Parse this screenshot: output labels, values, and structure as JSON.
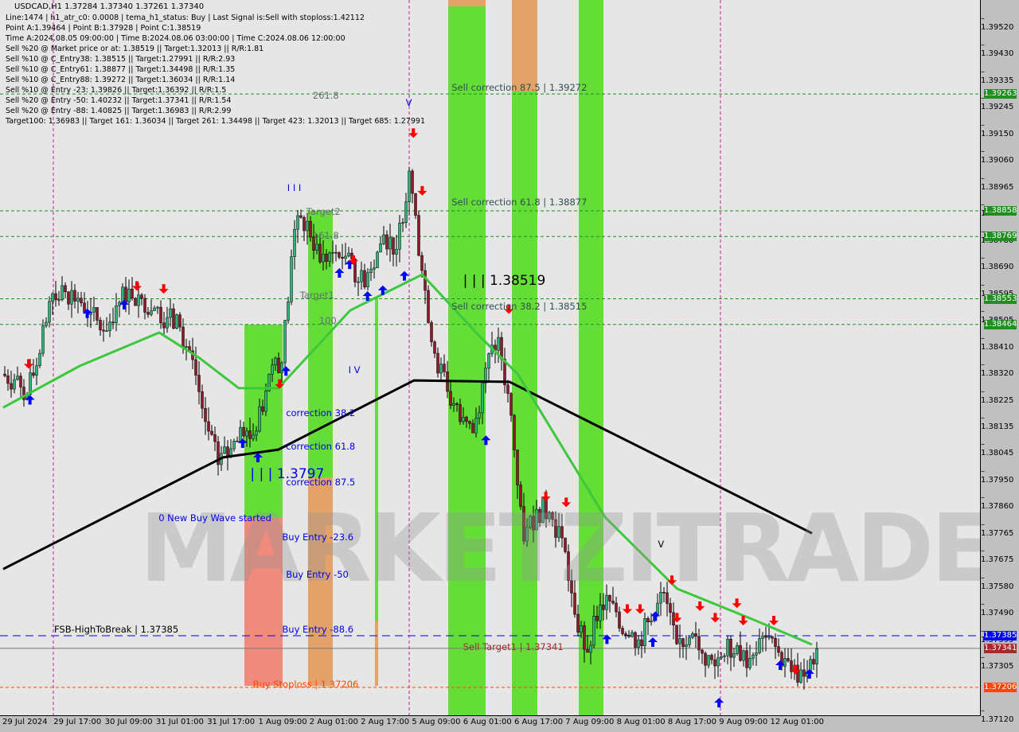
{
  "header": {
    "title": "USDCAD,H1  1.37284 1.37340 1.37261 1.37340",
    "lines": [
      "Line:1474 | h1_atr_c0: 0.0008 | tema_h1_status: Buy | Last Signal is:Sell with stoploss:1.42112",
      "Point A:1.39464 | Point B:1.37928 | Point C:1.38519",
      "Time A:2024.08.05 09:00:00 | Time B:2024.08.06 03:00:00 | Time C:2024.08.06 12:00:00",
      "Sell %20 @ Market price or at: 1.38519 || Target:1.32013 || R/R:1.81",
      "Sell %10 @ C_Entry38: 1.38515 || Target:1.27991 || R/R:2.93",
      "Sell %10 @ C_Entry61: 1.38877 || Target:1.34498 || R/R:1.35",
      "Sell %10 @ C_Entry88: 1.39272 || Target:1.36034 || R/R:1.14",
      "Sell %10 @ Entry -23: 1.39826 || Target:1.36392 || R/R:1.5",
      "Sell %20 @ Entry -50: 1.40232 || Target:1.37341 || R/R:1.54",
      "Sell %20 @ Entry -88: 1.40825 || Target:1.36983 || R/R:2.99",
      "Target100: 1.36983 || Target 161: 1.36034 || Target 261: 1.34498 || Target 423: 1.32013 || Target 685: 1.27991"
    ]
  },
  "watermark": "MARKETZITRADE",
  "colors": {
    "bull": "#2fb47a",
    "bear": "#8b1a2a",
    "ma_fast": "#3cc83c",
    "ma_slow": "#000000",
    "green_zone": "#55dd22",
    "orange_zone": "#e39a5a",
    "salmon_zone": "#f08070",
    "level_green": "#1f8f1f",
    "level_blue": "#0000ff",
    "level_red": "#a52a2a",
    "level_orange": "#ff4500"
  },
  "chart_data": {
    "type": "candlestick",
    "symbol": "USDCAD",
    "timeframe": "H1",
    "ylim": [
      1.3712,
      1.3952
    ],
    "y_ticks": [
      "1.39520",
      "1.39430",
      "1.39335",
      "1.39245",
      "1.39150",
      "1.39060",
      "1.38965",
      "1.38875",
      "1.38780",
      "1.38690",
      "1.38595",
      "1.38505",
      "1.38410",
      "1.38320",
      "1.38225",
      "1.38135",
      "1.38045",
      "1.37950",
      "1.37860",
      "1.37765",
      "1.37675",
      "1.37580",
      "1.37490",
      "1.37395",
      "1.37305",
      "1.37120"
    ],
    "x_ticks": [
      "29 Jul 2024",
      "29 Jul 17:00",
      "30 Jul 09:00",
      "31 Jul 01:00",
      "31 Jul 17:00",
      "1 Aug 09:00",
      "2 Aug 01:00",
      "2 Aug 17:00",
      "5 Aug 09:00",
      "6 Aug 01:00",
      "6 Aug 17:00",
      "7 Aug 09:00",
      "8 Aug 01:00",
      "8 Aug 17:00",
      "9 Aug 09:00",
      "12 Aug 01:00"
    ],
    "closes_4h": [
      1.38292,
      1.38273,
      1.38221,
      1.38364,
      1.38571,
      1.38577,
      1.38555,
      1.38507,
      1.38441,
      1.38529,
      1.38587,
      1.38555,
      1.38521,
      1.38488,
      1.38455,
      1.38342,
      1.38127,
      1.37978,
      1.38033,
      1.38077,
      1.38094,
      1.38292,
      1.38331,
      1.38794,
      1.38822,
      1.38681,
      1.38714,
      1.38701,
      1.38612,
      1.38656,
      1.38775,
      1.38725,
      1.38996,
      1.38651,
      1.38364,
      1.38232,
      1.38127,
      1.38088,
      1.38312,
      1.38419,
      1.38149,
      1.37713,
      1.37823,
      1.37812,
      1.37724,
      1.37459,
      1.37327,
      1.37492,
      1.37498,
      1.37387,
      1.37371,
      1.37437,
      1.37534,
      1.37357,
      1.37379,
      1.37324,
      1.3728,
      1.37373,
      1.37299,
      1.37318,
      1.37379,
      1.37327,
      1.3726,
      1.37244,
      1.3734
    ],
    "series": [
      {
        "kind": "ma_slow",
        "points": [
          [
            0,
            1.37616
          ],
          [
            17.25,
            1.38003
          ],
          [
            21.6,
            1.3803
          ],
          [
            32.25,
            1.3827
          ],
          [
            39.75,
            1.38265
          ],
          [
            47.25,
            1.38099
          ],
          [
            56,
            1.37906
          ],
          [
            63.5,
            1.3774
          ]
        ]
      },
      {
        "kind": "ma_fast",
        "points": [
          [
            0,
            1.38176
          ],
          [
            6,
            1.3832
          ],
          [
            12.25,
            1.38436
          ],
          [
            15.4,
            1.38348
          ],
          [
            18.5,
            1.38243
          ],
          [
            21.6,
            1.38243
          ],
          [
            27.25,
            1.38513
          ],
          [
            32.9,
            1.38637
          ],
          [
            37.25,
            1.3843
          ],
          [
            40.4,
            1.38292
          ],
          [
            47.25,
            1.37796
          ],
          [
            52.9,
            1.37548
          ],
          [
            59.1,
            1.37437
          ],
          [
            63.5,
            1.37354
          ]
        ]
      }
    ],
    "levels": [
      {
        "price": 1.39263,
        "badge": "1.39263",
        "color": "green",
        "style": "dash"
      },
      {
        "price": 1.38858,
        "badge": "1.38858",
        "color": "green",
        "style": "dash"
      },
      {
        "price": 1.38769,
        "badge": "1.38769",
        "color": "green",
        "style": "dash"
      },
      {
        "price": 1.38553,
        "badge": "1.38553",
        "color": "green",
        "style": "dash"
      },
      {
        "price": 1.38464,
        "badge": "1.38464",
        "color": "green",
        "style": "dash"
      },
      {
        "price": 1.37385,
        "badge": "1.37385",
        "color": "blue",
        "style": "longdash"
      },
      {
        "price": 1.37341,
        "badge": "1.37341",
        "color": "red",
        "style": "solid"
      },
      {
        "price": 1.37206,
        "badge": "1.37206",
        "color": "orange",
        "style": "dash"
      }
    ],
    "annotations": [
      {
        "text": "Sell correction 87.5 | 1.39272",
        "k": 35.2,
        "price": 1.39272,
        "color": "#2f4f4f"
      },
      {
        "text": "Sell correction 61.8 | 1.38877",
        "k": 35.2,
        "price": 1.38877,
        "color": "#2f4f4f"
      },
      {
        "text": "Sell correction 38.2 | 1.38515",
        "k": 35.2,
        "price": 1.38515,
        "color": "#2f4f4f"
      },
      {
        "text": "261.8",
        "k": 24.3,
        "price": 1.39245,
        "color": "#607070"
      },
      {
        "text": "Target2",
        "k": 23.8,
        "price": 1.38844,
        "color": "#607070"
      },
      {
        "text": "161.8",
        "k": 24.3,
        "price": 1.38761,
        "color": "#607070"
      },
      {
        "text": "Target1",
        "k": 23.3,
        "price": 1.38553,
        "color": "#607070"
      },
      {
        "text": "100",
        "k": 24.8,
        "price": 1.38464,
        "color": "#607070"
      },
      {
        "text": "correction 38.2",
        "k": 22.2,
        "price": 1.38145,
        "color": "#0000ee"
      },
      {
        "text": "correction 61.8",
        "k": 22.2,
        "price": 1.3803,
        "color": "#0000ee"
      },
      {
        "text": "correction 87.5",
        "k": 22.2,
        "price": 1.37905,
        "color": "#0000ee"
      },
      {
        "text": "0 New Buy Wave started",
        "k": 12.2,
        "price": 1.37782,
        "color": "#0000ee"
      },
      {
        "text": "Buy Entry -23.6",
        "k": 21.9,
        "price": 1.37715,
        "color": "#0000ee"
      },
      {
        "text": "Buy Entry -50",
        "k": 22.2,
        "price": 1.37585,
        "color": "#0000ee"
      },
      {
        "text": "Buy Entry -88.6",
        "k": 21.9,
        "price": 1.37395,
        "color": "#0000ee"
      },
      {
        "text": "FSB-HighToBreak | 1.37385",
        "k": 4,
        "price": 1.37395,
        "color": "#000000"
      },
      {
        "text": "Sell Target1 | 1.37341",
        "k": 36.1,
        "price": 1.37335,
        "color": "#a52a2a"
      },
      {
        "text": "Buy Stoploss | 1.37206",
        "k": 19.6,
        "price": 1.37205,
        "color": "#ff4500"
      },
      {
        "text": "| | | 1.3797",
        "k": 19.4,
        "price": 1.37925,
        "color": "#0000ee",
        "big": true
      },
      {
        "text": "| | | 1.38519",
        "k": 36.1,
        "price": 1.38596,
        "color": "#000000",
        "big": true
      },
      {
        "text": "I I I",
        "k": 22.3,
        "price": 1.38925,
        "color": "#0000ee"
      },
      {
        "text": "V",
        "k": 31.6,
        "price": 1.3922,
        "color": "#0000ee"
      },
      {
        "text": "I V",
        "k": 27.1,
        "price": 1.38295,
        "color": "#0000ee"
      },
      {
        "text": "V",
        "k": 51.4,
        "price": 1.3769,
        "color": "#000000"
      }
    ],
    "signals": [
      {
        "dir": "down",
        "k": 2,
        "price": 1.3833
      },
      {
        "dir": "up",
        "k": 2.1,
        "price": 1.382
      },
      {
        "dir": "up",
        "k": 6.6,
        "price": 1.385
      },
      {
        "dir": "up",
        "k": 9.5,
        "price": 1.3853
      },
      {
        "dir": "down",
        "k": 10.5,
        "price": 1.386
      },
      {
        "dir": "down",
        "k": 12.6,
        "price": 1.3859
      },
      {
        "dir": "up",
        "k": 18.8,
        "price": 1.3805
      },
      {
        "dir": "up",
        "k": 20,
        "price": 1.38
      },
      {
        "dir": "down",
        "k": 21.7,
        "price": 1.3826
      },
      {
        "dir": "up",
        "k": 22.2,
        "price": 1.383
      },
      {
        "dir": "up",
        "k": 26.4,
        "price": 1.3864
      },
      {
        "dir": "up",
        "k": 27.2,
        "price": 1.3867
      },
      {
        "dir": "down",
        "k": 27.5,
        "price": 1.3869
      },
      {
        "dir": "up",
        "k": 28.6,
        "price": 1.3856
      },
      {
        "dir": "up",
        "k": 29.8,
        "price": 1.3858
      },
      {
        "dir": "up",
        "k": 31.5,
        "price": 1.3863
      },
      {
        "dir": "down",
        "k": 32.2,
        "price": 1.3913
      },
      {
        "dir": "down",
        "k": 32.9,
        "price": 1.3893
      },
      {
        "dir": "down",
        "k": 39.7,
        "price": 1.3852
      },
      {
        "dir": "up",
        "k": 37.9,
        "price": 1.3806
      },
      {
        "dir": "down",
        "k": 42.6,
        "price": 1.3787
      },
      {
        "dir": "down",
        "k": 44.2,
        "price": 1.3785
      },
      {
        "dir": "up",
        "k": 47.4,
        "price": 1.3737
      },
      {
        "dir": "down",
        "k": 49,
        "price": 1.3748
      },
      {
        "dir": "down",
        "k": 50,
        "price": 1.3748
      },
      {
        "dir": "up",
        "k": 51,
        "price": 1.3736
      },
      {
        "dir": "up",
        "k": 51.2,
        "price": 1.3745
      },
      {
        "dir": "down",
        "k": 52.5,
        "price": 1.3758
      },
      {
        "dir": "down",
        "k": 52.9,
        "price": 1.3745
      },
      {
        "dir": "down",
        "k": 54.7,
        "price": 1.3749
      },
      {
        "dir": "down",
        "k": 55.9,
        "price": 1.3745
      },
      {
        "dir": "down",
        "k": 57.6,
        "price": 1.375
      },
      {
        "dir": "down",
        "k": 58.1,
        "price": 1.3744
      },
      {
        "dir": "down",
        "k": 60.5,
        "price": 1.3744
      },
      {
        "dir": "up",
        "k": 61,
        "price": 1.3728
      },
      {
        "dir": "down",
        "k": 62.2,
        "price": 1.3727
      },
      {
        "dir": "up",
        "k": 63.3,
        "price": 1.3725
      },
      {
        "dir": "up",
        "k": 56.2,
        "price": 1.3715
      }
    ]
  }
}
